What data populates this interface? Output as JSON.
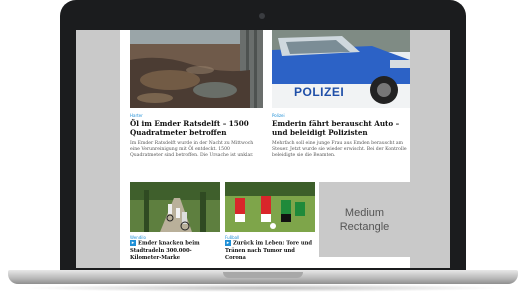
{
  "articles": [
    {
      "category": "Harter",
      "title": "Öl im Emder Ratsdelft – 1500 Quadratmeter betroffen",
      "teaser": "Im Emder Ratsdelft wurde in der Nacht zu Mittwoch eine Verunreinigung mit Öl entdeckt. 1500 Quadratmeter sind betroffen. Die Ursache ist unklar."
    },
    {
      "category": "Polizei",
      "title": "Emderin fährt berauscht Auto – und beleidigt Polizisten",
      "teaser": "Mehrfach soll eine junge Frau aus Emden berauscht am Steuer. Jetzt wurde sie wieder erwischt. Bei der Kontrolle beleidigte sie die Beamten."
    }
  ],
  "small_articles": [
    {
      "category": "Wendilo",
      "title": "Emder knacken beim Stadtradeln 300.000-Kilometer-Marke"
    },
    {
      "category": "Fußball",
      "title": "Zurück im Leben: Tore und Tränen nach Tumor und Corona"
    }
  ],
  "police_text": "POLIZEI",
  "ad": {
    "line1": "Medium",
    "line2": "Rectangle"
  },
  "colors": {
    "accent": "#1f8fd6",
    "ad_bg": "#c9c9c9",
    "frame": "#1b1c1e"
  }
}
